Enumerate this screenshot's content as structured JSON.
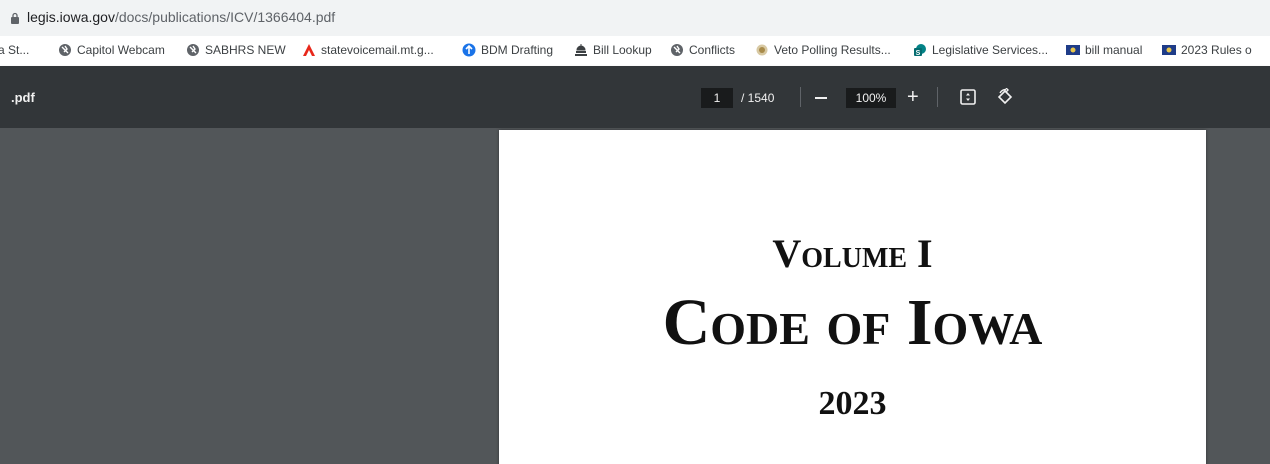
{
  "address_bar": {
    "url_host": "legis.iowa.gov",
    "url_path": "/docs/publications/ICV/1366404.pdf"
  },
  "bookmarks": [
    {
      "label": "a St...",
      "icon": "bookmark-icon"
    },
    {
      "label": "Capitol Webcam",
      "icon": "globe-icon"
    },
    {
      "label": "SABHRS NEW",
      "icon": "globe-icon"
    },
    {
      "label": "statevoicemail.mt.g...",
      "icon": "acrobat-icon"
    },
    {
      "label": "BDM Drafting",
      "icon": "ship-wheel-icon"
    },
    {
      "label": "Bill Lookup",
      "icon": "capitol-icon"
    },
    {
      "label": "Conflicts",
      "icon": "globe-icon"
    },
    {
      "label": "Veto Polling Results...",
      "icon": "seal-icon"
    },
    {
      "label": "Legislative Services...",
      "icon": "sharepoint-icon"
    },
    {
      "label": "bill manual",
      "icon": "flag-icon"
    },
    {
      "label": "2023 Rules o",
      "icon": "flag-icon"
    }
  ],
  "pdf_toolbar": {
    "title": ".pdf",
    "current_page": "1",
    "total_pages": "/ 1540",
    "zoom": "100%"
  },
  "document": {
    "volume": "Volume I",
    "title": "Code of Iowa",
    "year": "2023"
  },
  "colors": {
    "toolbar_bg": "#323639",
    "viewer_bg": "#525659",
    "address_bg": "#f1f3f4"
  }
}
